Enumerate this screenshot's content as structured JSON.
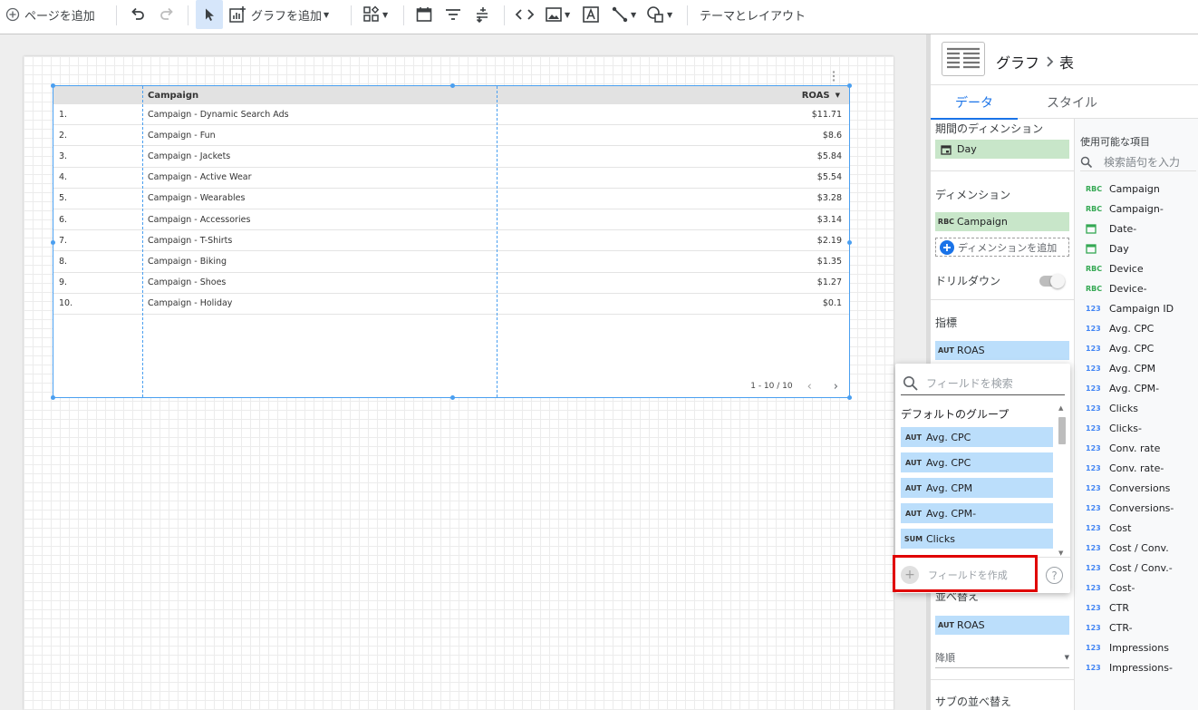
{
  "toolbar": {
    "add_page": "ページを追加",
    "add_chart": "グラフを追加",
    "theme_layout": "テーマとレイアウト"
  },
  "table": {
    "headers": {
      "campaign": "Campaign",
      "roas": "ROAS"
    },
    "rows": [
      {
        "idx": "1.",
        "campaign": "Campaign - Dynamic Search Ads",
        "roas": "$11.71"
      },
      {
        "idx": "2.",
        "campaign": "Campaign - Fun",
        "roas": "$8.6"
      },
      {
        "idx": "3.",
        "campaign": "Campaign - Jackets",
        "roas": "$5.84"
      },
      {
        "idx": "4.",
        "campaign": "Campaign - Active Wear",
        "roas": "$5.54"
      },
      {
        "idx": "5.",
        "campaign": "Campaign - Wearables",
        "roas": "$3.28"
      },
      {
        "idx": "6.",
        "campaign": "Campaign - Accessories",
        "roas": "$3.14"
      },
      {
        "idx": "7.",
        "campaign": "Campaign - T-Shirts",
        "roas": "$2.19"
      },
      {
        "idx": "8.",
        "campaign": "Campaign - Biking",
        "roas": "$1.35"
      },
      {
        "idx": "9.",
        "campaign": "Campaign - Shoes",
        "roas": "$1.27"
      },
      {
        "idx": "10.",
        "campaign": "Campaign - Holiday",
        "roas": "$0.1"
      }
    ],
    "pagination": "1 - 10 / 10"
  },
  "panel": {
    "breadcrumb_parent": "グラフ",
    "breadcrumb_current": "表",
    "tabs": {
      "data": "データ",
      "style": "スタイル"
    },
    "date_dimension_label": "期間のディメンション",
    "date_dimension_value": "Day",
    "dimension_label": "ディメンション",
    "dimension_type": "RBC",
    "dimension_value": "Campaign",
    "add_dimension": "ディメンションを追加",
    "drilldown_label": "ドリルダウン",
    "metric_label": "指標",
    "metric_type": "AUT",
    "metric_value": "ROAS",
    "sort_label": "並べ替え",
    "sort_type": "AUT",
    "sort_value": "ROAS",
    "sort_order": "降順",
    "sub_sort_label": "サブの並べ替え",
    "available_fields_label": "使用可能な項目",
    "fields_search_placeholder": "検索語句を入力",
    "fields": [
      {
        "type": "RBC",
        "name": "Campaign"
      },
      {
        "type": "RBC",
        "name": "Campaign-"
      },
      {
        "type": "date",
        "name": "Date-"
      },
      {
        "type": "date",
        "name": "Day"
      },
      {
        "type": "RBC",
        "name": "Device"
      },
      {
        "type": "RBC",
        "name": "Device-"
      },
      {
        "type": "123",
        "name": "Campaign ID"
      },
      {
        "type": "123",
        "name": "Avg. CPC"
      },
      {
        "type": "123",
        "name": "Avg. CPC"
      },
      {
        "type": "123",
        "name": "Avg. CPM"
      },
      {
        "type": "123",
        "name": "Avg. CPM-"
      },
      {
        "type": "123",
        "name": "Clicks"
      },
      {
        "type": "123",
        "name": "Clicks-"
      },
      {
        "type": "123",
        "name": "Conv. rate"
      },
      {
        "type": "123",
        "name": "Conv. rate-"
      },
      {
        "type": "123",
        "name": "Conversions"
      },
      {
        "type": "123",
        "name": "Conversions-"
      },
      {
        "type": "123",
        "name": "Cost"
      },
      {
        "type": "123",
        "name": "Cost / Conv."
      },
      {
        "type": "123",
        "name": "Cost / Conv.-"
      },
      {
        "type": "123",
        "name": "Cost-"
      },
      {
        "type": "123",
        "name": "CTR"
      },
      {
        "type": "123",
        "name": "CTR-"
      },
      {
        "type": "123",
        "name": "Impressions"
      },
      {
        "type": "123",
        "name": "Impressions-"
      }
    ]
  },
  "popup": {
    "search_placeholder": "フィールドを検索",
    "group_label": "デフォルトのグループ",
    "items": [
      {
        "type": "AUT",
        "name": "Avg. CPC"
      },
      {
        "type": "AUT",
        "name": "Avg. CPC"
      },
      {
        "type": "AUT",
        "name": "Avg. CPM"
      },
      {
        "type": "AUT",
        "name": "Avg. CPM-"
      },
      {
        "type": "SUM",
        "name": "Clicks"
      }
    ],
    "create_field": "フィールドを作成",
    "help": "?"
  }
}
